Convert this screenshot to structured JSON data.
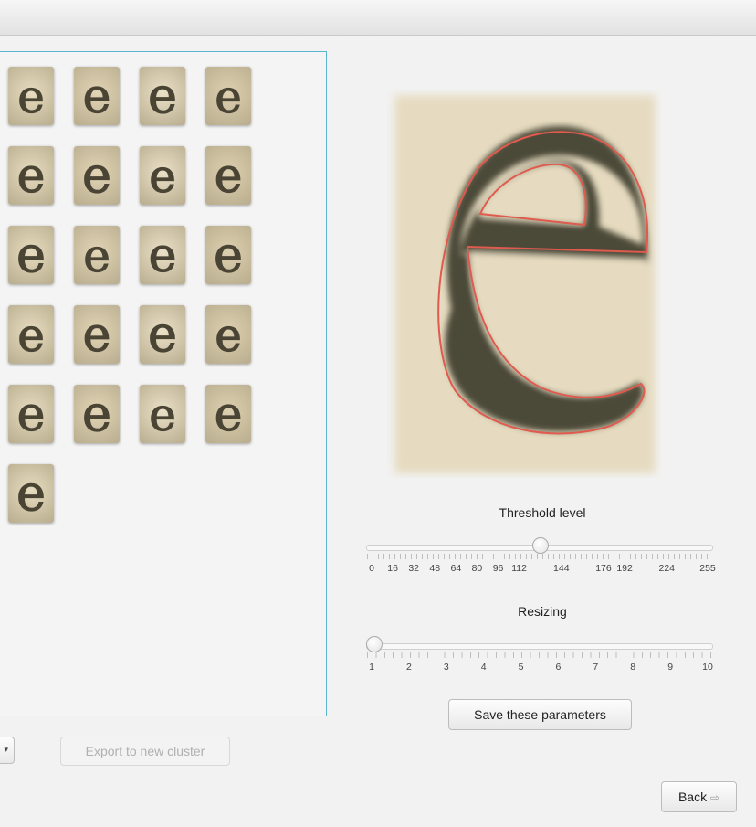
{
  "threshold": {
    "label": "Threshold level",
    "value": 128,
    "min": 0,
    "max": 255,
    "tick_labels": [
      "0",
      "16",
      "32",
      "48",
      "64",
      "80",
      "96",
      "112",
      "144",
      "176",
      "192",
      "224",
      "255"
    ]
  },
  "resizing": {
    "label": "Resizing",
    "value": 1,
    "min": 1,
    "max": 10,
    "tick_labels": [
      "1",
      "2",
      "3",
      "4",
      "5",
      "6",
      "7",
      "8",
      "9",
      "10"
    ]
  },
  "buttons": {
    "save": "Save these parameters",
    "export": "Export to new cluster",
    "back": "Back",
    "back_arrow": "⇨",
    "dropdown_arrow": "▾"
  },
  "glyphs": {
    "letter": "e",
    "count": 21,
    "tint_colors": [
      "#e8dcc0",
      "#e2d5b6",
      "#ebe1c8",
      "#dcd0b0"
    ],
    "ink_color": "#4a4434"
  },
  "preview": {
    "letter": "e",
    "contour_color": "#e05a4e",
    "paper_color": "#e6dbc0",
    "ink_color": "#4b4839"
  }
}
